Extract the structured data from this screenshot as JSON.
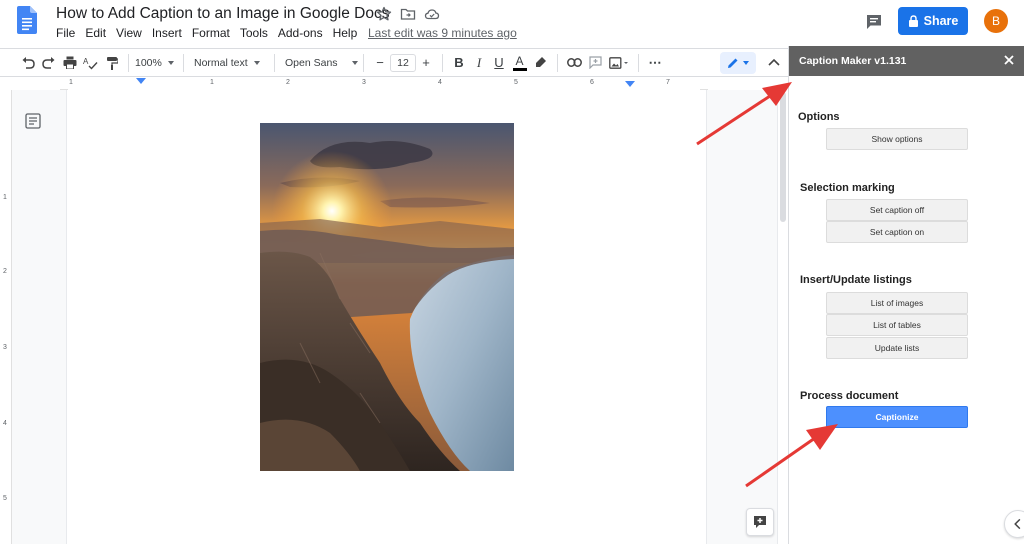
{
  "doc": {
    "title": "How to Add Caption to an Image in Google Docs",
    "last_edit": "Last edit was 9 minutes ago"
  },
  "menu": [
    "File",
    "Edit",
    "View",
    "Insert",
    "Format",
    "Tools",
    "Add-ons",
    "Help"
  ],
  "header": {
    "share_label": "Share",
    "avatar_initial": "B"
  },
  "toolbar": {
    "zoom": "100%",
    "style": "Normal text",
    "font": "Open Sans",
    "font_size": "12",
    "minus": "−",
    "plus": "+",
    "bold": "B",
    "italic": "I",
    "underline": "U",
    "text_color_letter": "A",
    "more": "⋯"
  },
  "ruler": {
    "labels": [
      "1",
      "1",
      "2",
      "3",
      "4",
      "5",
      "6",
      "7"
    ],
    "vlabels": [
      "1",
      "2",
      "3",
      "4",
      "5"
    ]
  },
  "sidebar": {
    "title": "Caption Maker v1.131",
    "sections": {
      "options": {
        "title": "Options",
        "buttons": [
          "Show options"
        ]
      },
      "selection": {
        "title": "Selection marking",
        "buttons": [
          "Set caption off",
          "Set caption on"
        ]
      },
      "listings": {
        "title": "Insert/Update listings",
        "buttons": [
          "List of images",
          "List of tables",
          "Update lists"
        ]
      },
      "process": {
        "title": "Process document",
        "buttons": [
          "Captionize"
        ]
      }
    }
  },
  "colors": {
    "share_blue": "#1a73e8",
    "avatar_orange": "#e8710a",
    "sidebar_header": "#616161",
    "captionize_blue": "#4d90fe",
    "arrow_red": "#e53935",
    "docs_blue": "#4285f4"
  },
  "icons": {
    "doc_logo": "google-docs-icon",
    "star": "star-icon",
    "move": "folder-icon",
    "cloud": "cloud-icon",
    "comments": "comment-icon",
    "share_lock": "lock-icon",
    "edit_mode": "pencil-icon",
    "explore": "explore-icon"
  }
}
